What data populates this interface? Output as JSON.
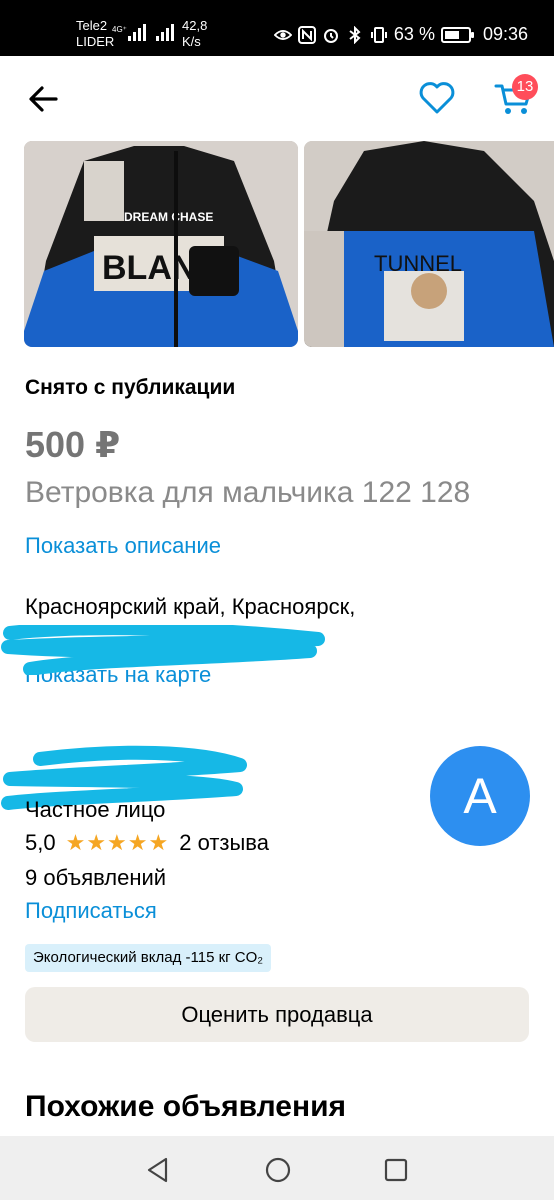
{
  "status_bar": {
    "carrier1": "Tele2",
    "carrier2": "LIDER",
    "network": "4G⁺",
    "speed_value": "42,8",
    "speed_unit": "K/s",
    "battery": "63 %",
    "battery_level": 0.63,
    "time": "09:36"
  },
  "header": {
    "back_icon": "arrow-left-icon",
    "favorite_icon": "heart-icon",
    "cart_icon": "cart-icon",
    "cart_count": "13"
  },
  "listing": {
    "status": "Снято с публикации",
    "price": "500 ₽",
    "title": "Ветровка для мальчика 122 128",
    "show_description": "Показать описание",
    "address_line1": "Красноярский край, Красноярск,",
    "show_on_map": "Показать на карте"
  },
  "seller": {
    "type": "Частное лицо",
    "rating": "5,0",
    "stars": 5,
    "reviews": "2 отзыва",
    "ads_count": "9 объявлений",
    "subscribe": "Подписаться",
    "avatar_letter": "A",
    "eco_badge": "Экологический вклад -115 кг CO₂",
    "rate_button": "Оценить продавца"
  },
  "similar": {
    "heading": "Похожие объявления"
  },
  "colors": {
    "accent_link": "#0a8fd8",
    "avatar": "#2d8ff0",
    "badge": "#ff4d5a",
    "stars": "#f5a623",
    "scribble": "#16b8e6"
  }
}
